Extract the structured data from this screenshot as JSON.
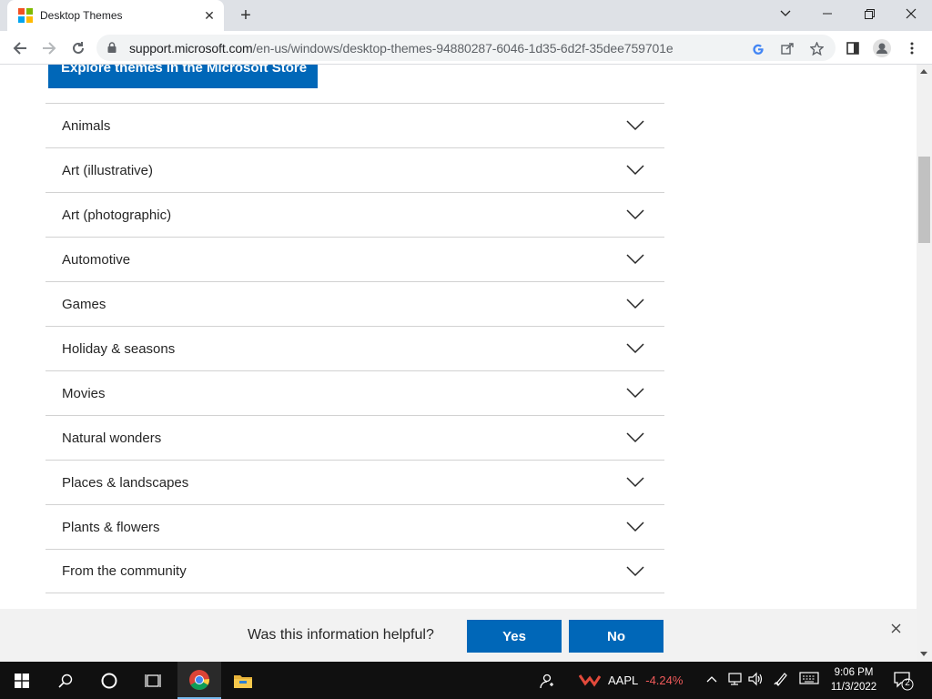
{
  "browser": {
    "tab_title": "Desktop Themes",
    "url_host": "support.microsoft.com",
    "url_path": "/en-us/windows/desktop-themes-94880287-6046-1d35-6d2f-35dee759701e"
  },
  "page": {
    "store_button": "Explore themes in the Microsoft Store",
    "categories": [
      "Animals",
      "Art (illustrative)",
      "Art (photographic)",
      "Automotive",
      "Games",
      "Holiday & seasons",
      "Movies",
      "Natural wonders",
      "Places & landscapes",
      "Plants & flowers",
      "From the community"
    ]
  },
  "feedback": {
    "question": "Was this information helpful?",
    "yes": "Yes",
    "no": "No"
  },
  "taskbar": {
    "stock_symbol": "AAPL",
    "stock_change": "-4.24%",
    "time": "9:06 PM",
    "date": "11/3/2022",
    "notification_count": "2"
  },
  "colors": {
    "accent": "#0067b8",
    "stock_down": "#f05a5a"
  }
}
